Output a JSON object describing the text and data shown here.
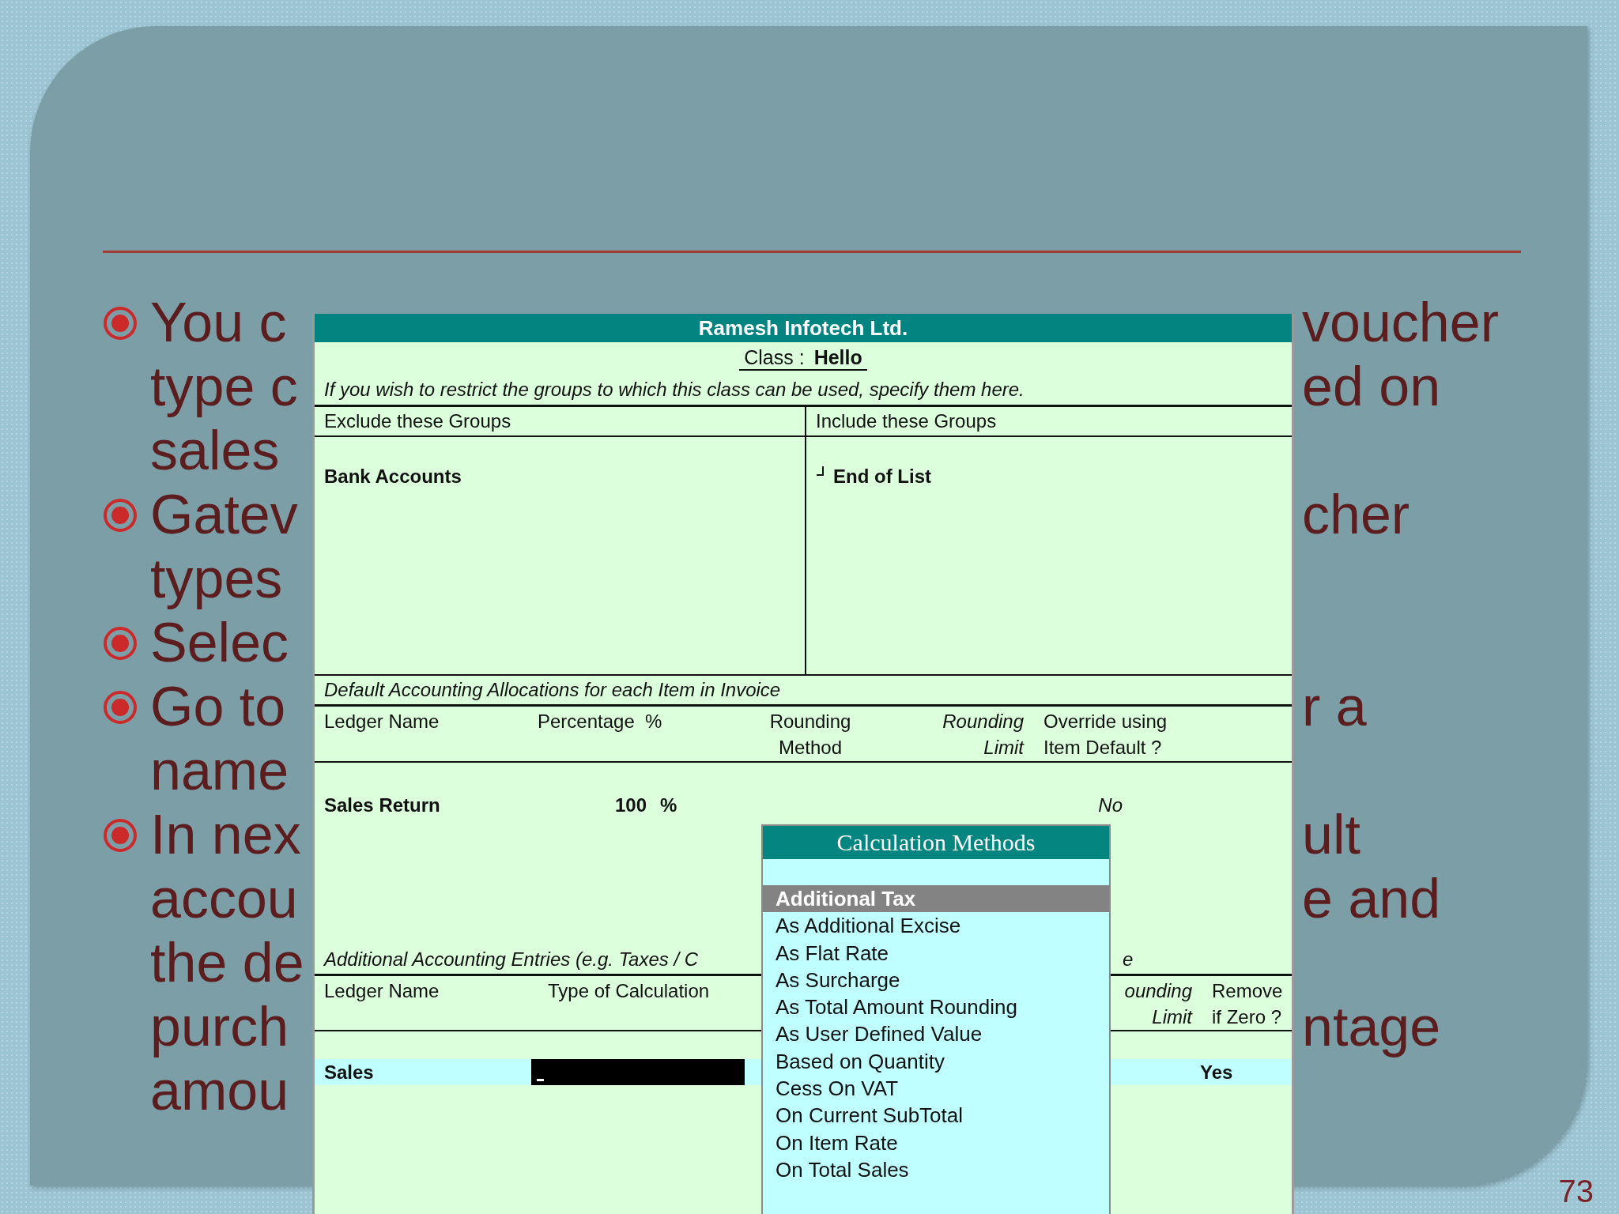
{
  "slide": {
    "bullets": [
      {
        "lines": [
          {
            "left": "You c",
            "right": "voucher"
          },
          {
            "left": "type c",
            "right": "ed on"
          },
          {
            "left": "sales"
          }
        ]
      },
      {
        "lines": [
          {
            "left": "Gatev",
            "right": "cher"
          },
          {
            "left": "types"
          }
        ]
      },
      {
        "lines": [
          {
            "left": "Selec"
          }
        ]
      },
      {
        "lines": [
          {
            "left": "Go to",
            "right": "r a"
          },
          {
            "left": "name"
          }
        ]
      },
      {
        "lines": [
          {
            "left": "In nex",
            "right": "ult"
          },
          {
            "left": "accou",
            "right": "e and"
          },
          {
            "left": "the de"
          },
          {
            "left": "purch",
            "right": "ntage"
          },
          {
            "left": "amou"
          }
        ]
      }
    ],
    "page_number": "73"
  },
  "window": {
    "title": "Ramesh Infotech Ltd.",
    "class_label": "Class :",
    "class_value": "Hello",
    "note": "If you wish to restrict the groups to which this class can be used, specify them here.",
    "groups": [
      {
        "heading": "Exclude these Groups",
        "items": [
          {
            "label": "Bank Accounts",
            "kind": "plain"
          }
        ]
      },
      {
        "heading": "Include these Groups",
        "items": [
          {
            "label": "End of List",
            "kind": "end"
          }
        ]
      }
    ],
    "allocations": {
      "title": "Default Accounting Allocations for each Item in Invoice",
      "columns": [
        {
          "label": "Ledger Name",
          "italic": false
        },
        {
          "label": "Percentage  %",
          "italic": false
        },
        {
          "label": "Rounding\nMethod",
          "italic": false
        },
        {
          "label": "Rounding\nLimit",
          "italic": true
        },
        {
          "label": "Override using\nItem Default ?",
          "italic": false
        }
      ],
      "rows": [
        {
          "ledger": "Sales Return",
          "percentage": "100",
          "unit": "%",
          "override": "No"
        }
      ]
    },
    "additional": {
      "title": "Additional Accounting Entries (e.g. Taxes / C",
      "title_tail": "e",
      "columns": [
        {
          "label": "Ledger Name",
          "italic": false
        },
        {
          "label": "Type of Calculation",
          "italic": false
        },
        {
          "label": "ounding\nLimit",
          "italic": true
        },
        {
          "label": "Remove\nif Zero ?",
          "italic": false
        }
      ],
      "rows": [
        {
          "ledger": "Sales",
          "remove": "Yes",
          "selected": true
        }
      ]
    },
    "popup": {
      "title": "Calculation Methods",
      "items": [
        {
          "label": "Additional Tax",
          "selected": true
        },
        {
          "label": "As Additional Excise",
          "selected": false
        },
        {
          "label": "As Flat Rate",
          "selected": false
        },
        {
          "label": "As Surcharge",
          "selected": false
        },
        {
          "label": "As Total Amount Rounding",
          "selected": false
        },
        {
          "label": "As User Defined Value",
          "selected": false
        },
        {
          "label": "Based on Quantity",
          "selected": false
        },
        {
          "label": "Cess On VAT",
          "selected": false
        },
        {
          "label": "On Current SubTotal",
          "selected": false
        },
        {
          "label": "On Item Rate",
          "selected": false
        },
        {
          "label": "On Total Sales",
          "selected": false
        }
      ]
    }
  }
}
